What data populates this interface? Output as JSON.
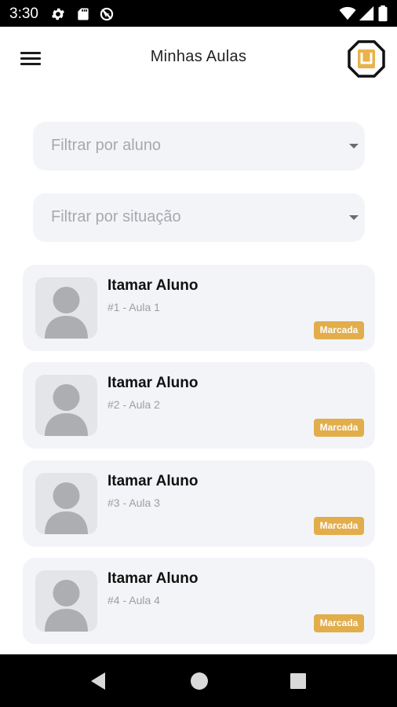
{
  "status_bar": {
    "time": "3:30",
    "left_icons": [
      "gear-icon",
      "sd-card-icon",
      "no-location-icon"
    ],
    "right_icons": [
      "wifi-icon",
      "signal-icon",
      "battery-icon"
    ]
  },
  "app_bar": {
    "title": "Minhas Aulas",
    "menu_icon": "hamburger-menu-icon",
    "logo_icon": "octagon-logo-icon"
  },
  "filters": [
    {
      "placeholder": "Filtrar por aluno",
      "value": ""
    },
    {
      "placeholder": "Filtrar por situação",
      "value": ""
    }
  ],
  "lessons": [
    {
      "student": "Itamar Aluno",
      "subtitle": "#1 - Aula 1",
      "status": "Marcada"
    },
    {
      "student": "Itamar Aluno",
      "subtitle": "#2 - Aula 2",
      "status": "Marcada"
    },
    {
      "student": "Itamar Aluno",
      "subtitle": "#3 - Aula 3",
      "status": "Marcada"
    },
    {
      "student": "Itamar Aluno",
      "subtitle": "#4 - Aula 4",
      "status": "Marcada"
    }
  ],
  "nav_bar": {
    "buttons": [
      "back-icon",
      "home-icon",
      "recents-icon"
    ]
  },
  "colors": {
    "badge": "#e2ad4b",
    "card_bg": "#f3f4f7",
    "logo_accent": "#e9b24a"
  }
}
